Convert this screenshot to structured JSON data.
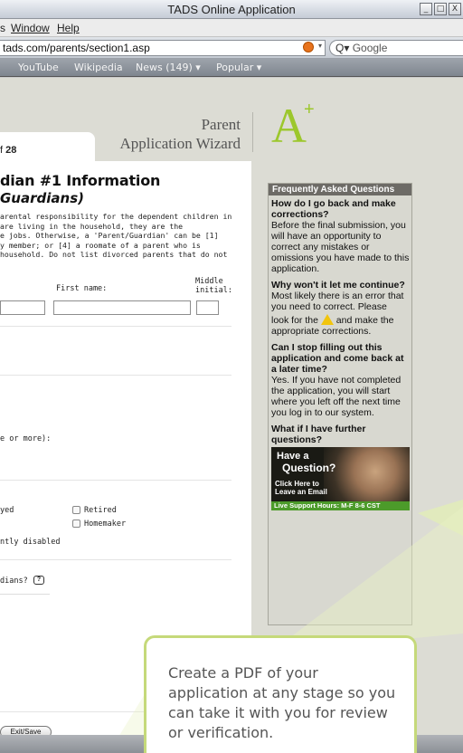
{
  "window": {
    "title": "TADS Online Application",
    "buttons": [
      "_",
      "□",
      "X"
    ]
  },
  "menu": {
    "items": [
      {
        "prefix": "s ",
        "label": "Window",
        "accel": "W"
      },
      {
        "label": "Help",
        "accel": "H"
      }
    ],
    "s": "s",
    "window": "Window",
    "help": "Help"
  },
  "navbar": {
    "url": "tads.com/parents/section1.asp",
    "search_placeholder": "Google",
    "search_prefix": "Q▾"
  },
  "bookmarks": {
    "items": [
      "YouTube",
      "Wikipedia",
      "News (149) ▾",
      "Popular ▾"
    ]
  },
  "header": {
    "wizard_line1": "Parent",
    "wizard_line2": "Application Wizard",
    "logo": "A",
    "logo_sup": "+"
  },
  "tab": {
    "page_prefix": "f ",
    "page_total": "28"
  },
  "section": {
    "title": "dian #1 Information",
    "subtitle": "Guardians)",
    "description": "arental responsibility for the dependent children in\nare living in the household, they are the\ne jobs. Otherwise, a 'Parent/Guardian' can be [1]\ny member; or [4] a roomate of a parent who is\nhousehold. Do not list divorced parents that do not"
  },
  "form": {
    "first_name_label": "First name:",
    "middle_initial_label": "Middle\ninitial:",
    "one_or_more_label": "e or more):",
    "employed_label": "yed",
    "retired_label": "Retired",
    "homemaker_label": "Homemaker",
    "disabled_label": "ntly disabled",
    "guardians_q_label": "dians?",
    "help_glyph": "?",
    "exit_button": "Exit/Save"
  },
  "faq": {
    "header": "Frequently Asked Questions",
    "q1": "How do I go back and make corrections?",
    "a1": "Before the final submission, you will have an opportunity to correct any mistakes or omissions you have made to this application.",
    "q2": "Why won't it let me continue?",
    "a2a": "Most likely there is an error that you need to correct. Please",
    "a2b_pre": "look for the",
    "a2b_post": "and make the appropriate corrections.",
    "q3": "Can I stop filling out this application and come back at a later time?",
    "a3": "Yes. If you have not completed the application, you will start where you left off the next time you log in to our system.",
    "q4": "What if I have further questions?",
    "ad_line1": "Have a",
    "ad_line2": "Question?",
    "ad_line3": "Click Here to\nLeave an Email",
    "ad_hours": "Live Support Hours: M-F 8-6 CST"
  },
  "callout": {
    "text": "Create a PDF of your application at any stage so you can take it with you for review or verification."
  },
  "colors": {
    "accent_green": "#9cc72c",
    "callout_border": "#c5d97a",
    "faq_header": "#6d6b66",
    "support_bar": "#4c9b2a"
  }
}
